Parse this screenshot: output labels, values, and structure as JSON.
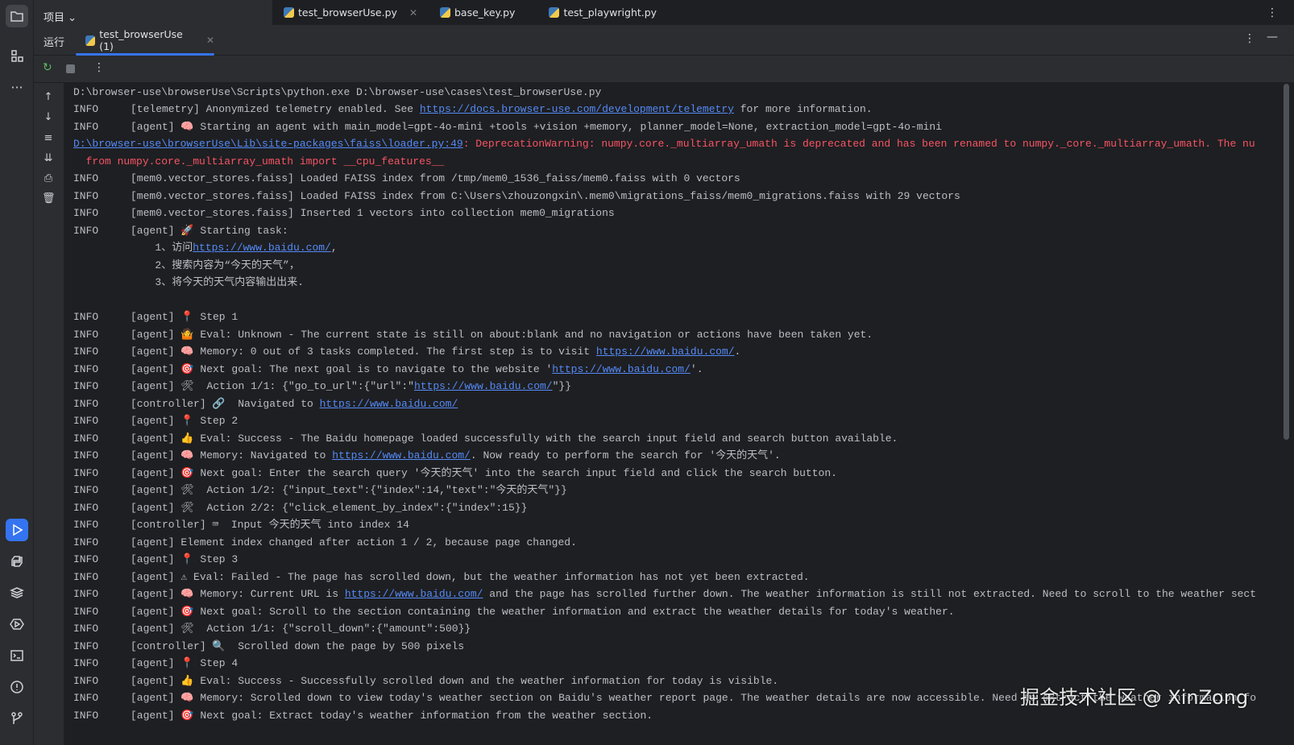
{
  "header": {
    "project_label": "项目 ⌄",
    "editor_tabs": [
      {
        "label": "test_browserUse.py",
        "closable": true
      },
      {
        "label": "base_key.py"
      },
      {
        "label": "test_playwright.py"
      }
    ]
  },
  "run": {
    "label": "运行",
    "tab_label": "test_browserUse (1)"
  },
  "colors": {
    "accent": "#3574f0",
    "link": "#548af7",
    "error": "#f75464"
  },
  "watermark": "掘金技术社区 @ XinZong",
  "console": {
    "lines": [
      [
        [
          "t",
          "D:\\browser-use\\browserUse\\Scripts\\python.exe D:\\browser-use\\cases\\test_browserUse.py"
        ]
      ],
      [
        [
          "l",
          "INFO"
        ],
        [
          "t",
          "[telemetry] Anonymized telemetry enabled. See "
        ],
        [
          "a",
          "https://docs.browser-use.com/development/telemetry"
        ],
        [
          "t",
          " for more information."
        ]
      ],
      [
        [
          "l",
          "INFO"
        ],
        [
          "t",
          "[agent] 🧠 Starting an agent with main_model=gpt-4o-mini +tools +vision +memory, planner_model=None, extraction_model=gpt-4o-mini"
        ]
      ],
      [
        [
          "a",
          "D:\\browser-use\\browserUse\\Lib\\site-packages\\faiss\\loader.py:49"
        ],
        [
          "e",
          ": DeprecationWarning: numpy.core._multiarray_umath is deprecated and has been renamed to numpy._core._multiarray_umath. The nu"
        ]
      ],
      [
        [
          "e",
          "  from numpy.core._multiarray_umath import __cpu_features__"
        ]
      ],
      [
        [
          "l",
          "INFO"
        ],
        [
          "t",
          "[mem0.vector_stores.faiss] Loaded FAISS index from /tmp/mem0_1536_faiss/mem0.faiss with 0 vectors"
        ]
      ],
      [
        [
          "l",
          "INFO"
        ],
        [
          "t",
          "[mem0.vector_stores.faiss] Loaded FAISS index from C:\\Users\\zhouzongxin\\.mem0\\migrations_faiss/mem0_migrations.faiss with 29 vectors"
        ]
      ],
      [
        [
          "l",
          "INFO"
        ],
        [
          "t",
          "[mem0.vector_stores.faiss] Inserted 1 vectors into collection mem0_migrations"
        ]
      ],
      [
        [
          "l",
          "INFO"
        ],
        [
          "t",
          "[agent] 🚀 Starting task:"
        ]
      ],
      [
        [
          "t",
          "             1、访问"
        ],
        [
          "a",
          "https://www.baidu.com/"
        ],
        [
          "t",
          ","
        ]
      ],
      [
        [
          "t",
          "             2、搜索内容为“今天的天气”，"
        ]
      ],
      [
        [
          "t",
          "             3、将今天的天气内容输出出来."
        ]
      ],
      [],
      [
        [
          "l",
          "INFO"
        ],
        [
          "t",
          "[agent] 📍 Step 1"
        ]
      ],
      [
        [
          "l",
          "INFO"
        ],
        [
          "t",
          "[agent] 🤷 Eval: Unknown - The current state is still on about:blank and no navigation or actions have been taken yet."
        ]
      ],
      [
        [
          "l",
          "INFO"
        ],
        [
          "t",
          "[agent] 🧠 Memory: 0 out of 3 tasks completed. The first step is to visit "
        ],
        [
          "a",
          "https://www.baidu.com/"
        ],
        [
          "t",
          "."
        ]
      ],
      [
        [
          "l",
          "INFO"
        ],
        [
          "t",
          "[agent] 🎯 Next goal: The next goal is to navigate to the website '"
        ],
        [
          "a",
          "https://www.baidu.com/"
        ],
        [
          "t",
          "'."
        ]
      ],
      [
        [
          "l",
          "INFO"
        ],
        [
          "t",
          "[agent] 🛠  Action 1/1: {\"go_to_url\":{\"url\":\""
        ],
        [
          "a",
          "https://www.baidu.com/"
        ],
        [
          "t",
          "\"}}"
        ]
      ],
      [
        [
          "l",
          "INFO"
        ],
        [
          "t",
          "[controller] 🔗  Navigated to "
        ],
        [
          "a",
          "https://www.baidu.com/"
        ]
      ],
      [
        [
          "l",
          "INFO"
        ],
        [
          "t",
          "[agent] 📍 Step 2"
        ]
      ],
      [
        [
          "l",
          "INFO"
        ],
        [
          "t",
          "[agent] 👍 Eval: Success - The Baidu homepage loaded successfully with the search input field and search button available."
        ]
      ],
      [
        [
          "l",
          "INFO"
        ],
        [
          "t",
          "[agent] 🧠 Memory: Navigated to "
        ],
        [
          "a",
          "https://www.baidu.com/"
        ],
        [
          "t",
          ". Now ready to perform the search for '今天的天气'."
        ]
      ],
      [
        [
          "l",
          "INFO"
        ],
        [
          "t",
          "[agent] 🎯 Next goal: Enter the search query '今天的天气' into the search input field and click the search button."
        ]
      ],
      [
        [
          "l",
          "INFO"
        ],
        [
          "t",
          "[agent] 🛠  Action 1/2: {\"input_text\":{\"index\":14,\"text\":\"今天的天气\"}}"
        ]
      ],
      [
        [
          "l",
          "INFO"
        ],
        [
          "t",
          "[agent] 🛠  Action 2/2: {\"click_element_by_index\":{\"index\":15}}"
        ]
      ],
      [
        [
          "l",
          "INFO"
        ],
        [
          "t",
          "[controller] ⌨  Input 今天的天气 into index 14"
        ]
      ],
      [
        [
          "l",
          "INFO"
        ],
        [
          "t",
          "[agent] Element index changed after action 1 / 2, because page changed."
        ]
      ],
      [
        [
          "l",
          "INFO"
        ],
        [
          "t",
          "[agent] 📍 Step 3"
        ]
      ],
      [
        [
          "l",
          "INFO"
        ],
        [
          "t",
          "[agent] ⚠ Eval: Failed - The page has scrolled down, but the weather information has not yet been extracted."
        ]
      ],
      [
        [
          "l",
          "INFO"
        ],
        [
          "t",
          "[agent] 🧠 Memory: Current URL is "
        ],
        [
          "a",
          "https://www.baidu.com/"
        ],
        [
          "t",
          " and the page has scrolled further down. The weather information is still not extracted. Need to scroll to the weather sect"
        ]
      ],
      [
        [
          "l",
          "INFO"
        ],
        [
          "t",
          "[agent] 🎯 Next goal: Scroll to the section containing the weather information and extract the weather details for today's weather."
        ]
      ],
      [
        [
          "l",
          "INFO"
        ],
        [
          "t",
          "[agent] 🛠  Action 1/1: {\"scroll_down\":{\"amount\":500}}"
        ]
      ],
      [
        [
          "l",
          "INFO"
        ],
        [
          "t",
          "[controller] 🔍  Scrolled down the page by 500 pixels"
        ]
      ],
      [
        [
          "l",
          "INFO"
        ],
        [
          "t",
          "[agent] 📍 Step 4"
        ]
      ],
      [
        [
          "l",
          "INFO"
        ],
        [
          "t",
          "[agent] 👍 Eval: Success - Successfully scrolled down and the weather information for today is visible."
        ]
      ],
      [
        [
          "l",
          "INFO"
        ],
        [
          "t",
          "[agent] 🧠 Memory: Scrolled down to view today's weather section on Baidu's weather report page. The weather details are now accessible. Need to extract the weather information fo"
        ]
      ],
      [
        [
          "l",
          "INFO"
        ],
        [
          "t",
          "[agent] 🎯 Next goal: Extract today's weather information from the weather section."
        ]
      ]
    ]
  }
}
